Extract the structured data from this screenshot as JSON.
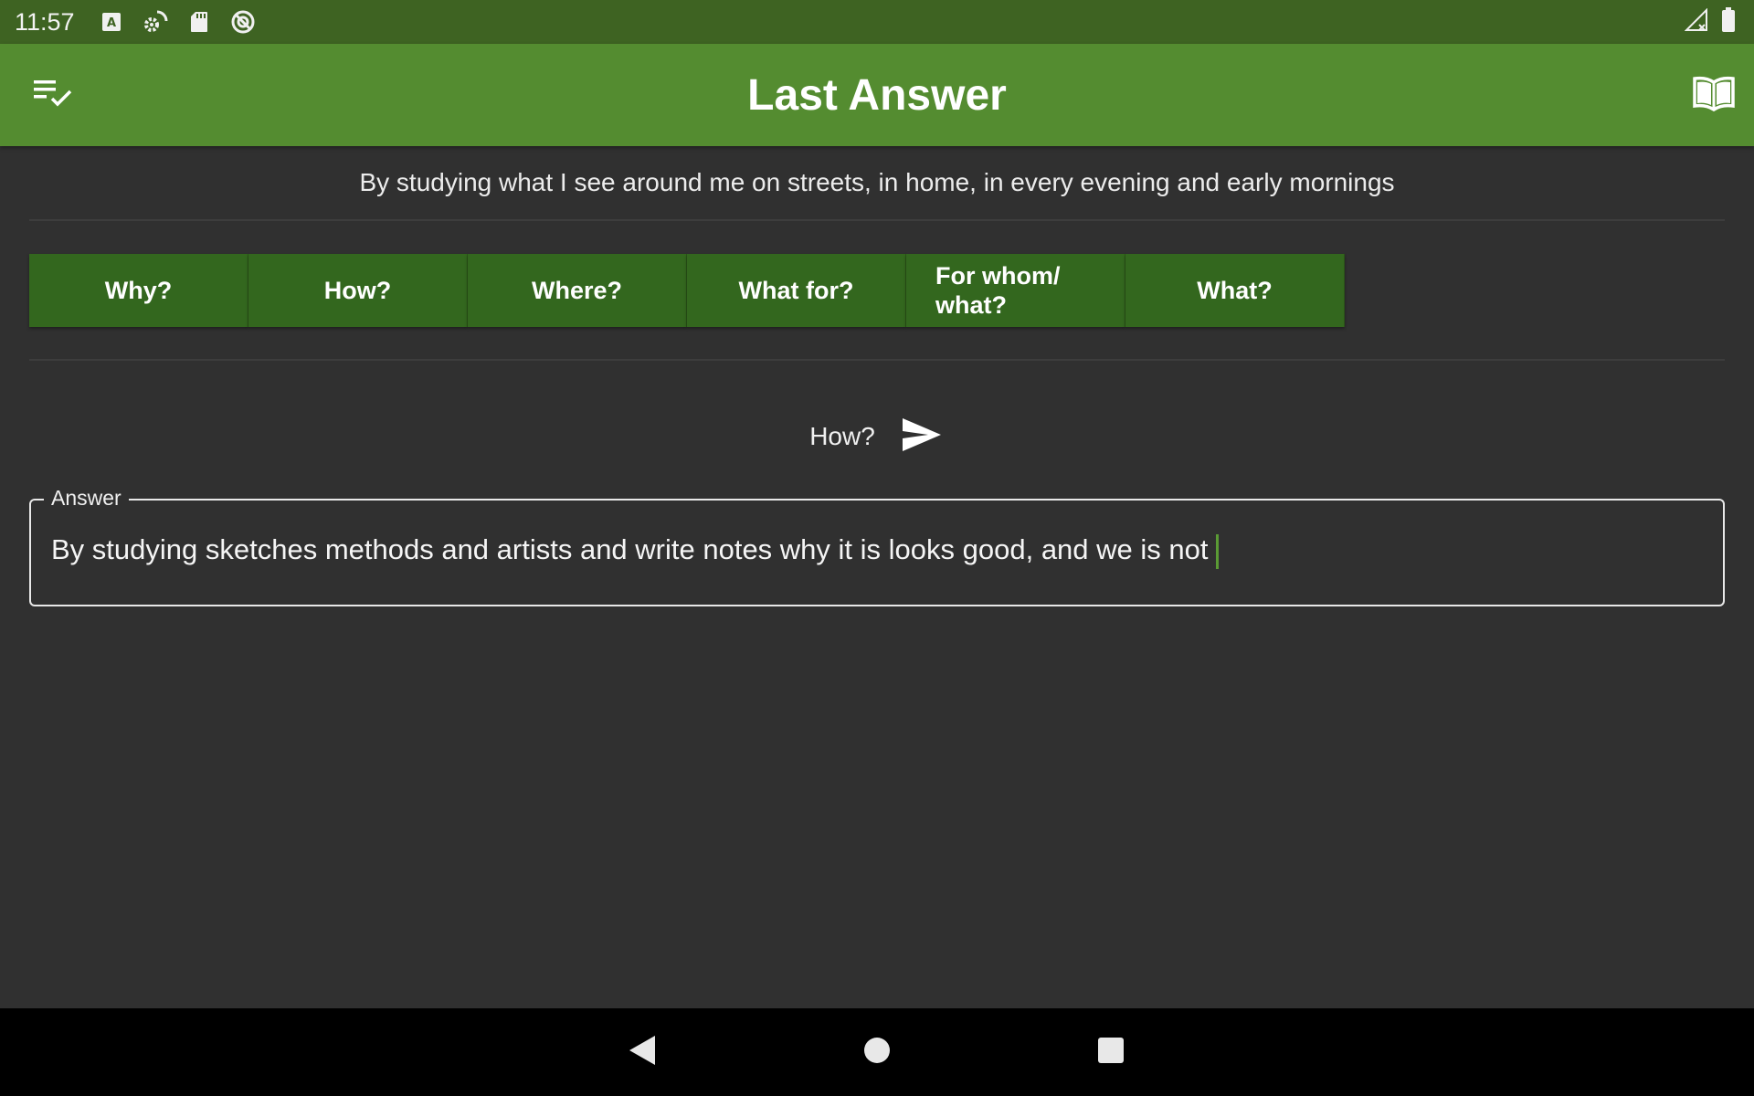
{
  "status_bar": {
    "time": "11:57",
    "left_icons": [
      "a-notification-icon",
      "settings-sync-icon",
      "sd-card-icon",
      "no-sync-icon"
    ],
    "right_icons": [
      "cellular-signal-icon",
      "battery-icon"
    ]
  },
  "app_bar": {
    "title": "Last Answer",
    "left_icon": "checklist-icon",
    "right_icon": "book-icon",
    "color": "#548c30"
  },
  "question": {
    "text": "By studying what I see around me on streets, in home, in every evening and early mornings"
  },
  "question_words": [
    {
      "label": "Why?"
    },
    {
      "label": "How?"
    },
    {
      "label": "Where?"
    },
    {
      "label": "What for?"
    },
    {
      "label": "For whom/\nwhat?"
    },
    {
      "label": "What?"
    }
  ],
  "send": {
    "label": "How?",
    "icon": "send-icon"
  },
  "answer": {
    "label": "Answer",
    "value": "By studying sketches methods and artists and write notes why it is looks good, and we is not"
  },
  "nav_bar": {
    "icons": [
      "back-icon",
      "home-icon",
      "recents-icon"
    ]
  },
  "colors": {
    "status_bar": "#3e6322",
    "button": "#33671e",
    "background": "#303030",
    "caret": "#5a9a34"
  }
}
